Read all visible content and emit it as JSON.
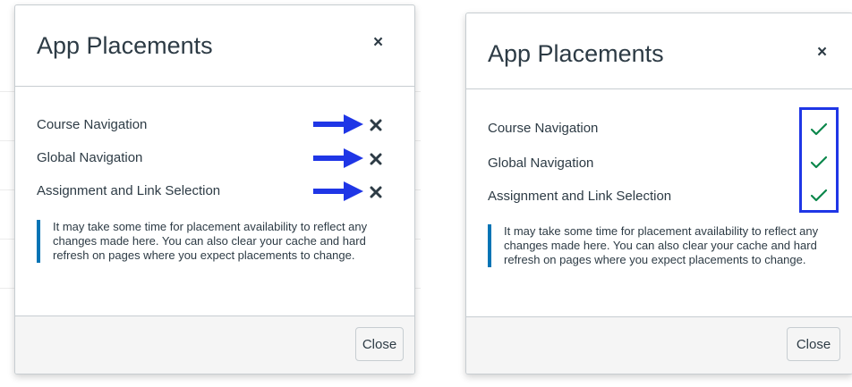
{
  "left_modal": {
    "title": "App Placements",
    "close_icon": "×",
    "placements": [
      {
        "label": "Course Navigation",
        "enabled": false
      },
      {
        "label": "Global Navigation",
        "enabled": false
      },
      {
        "label": "Assignment and Link Selection",
        "enabled": false
      }
    ],
    "info_text": "It may take some time for placement availability to reflect any changes made here. You can also clear your cache and hard refresh on pages where you expect placements to change.",
    "close_button": "Close"
  },
  "right_modal": {
    "title": "App Placements",
    "close_icon": "×",
    "placements": [
      {
        "label": "Course Navigation",
        "enabled": true
      },
      {
        "label": "Global Navigation",
        "enabled": true
      },
      {
        "label": "Assignment and Link Selection",
        "enabled": true
      }
    ],
    "info_text": "It may take some time for placement availability to reflect any changes made here. You can also clear your cache and hard refresh on pages where you expect placements to change.",
    "close_button": "Close"
  },
  "colors": {
    "annotation_blue": "#1f36e6",
    "enabled_green": "#0b874b",
    "info_border": "#0374b5"
  },
  "icons": {
    "disabled": "x-mark-icon",
    "enabled": "checkmark-icon",
    "annotation": "arrow-right-icon"
  }
}
